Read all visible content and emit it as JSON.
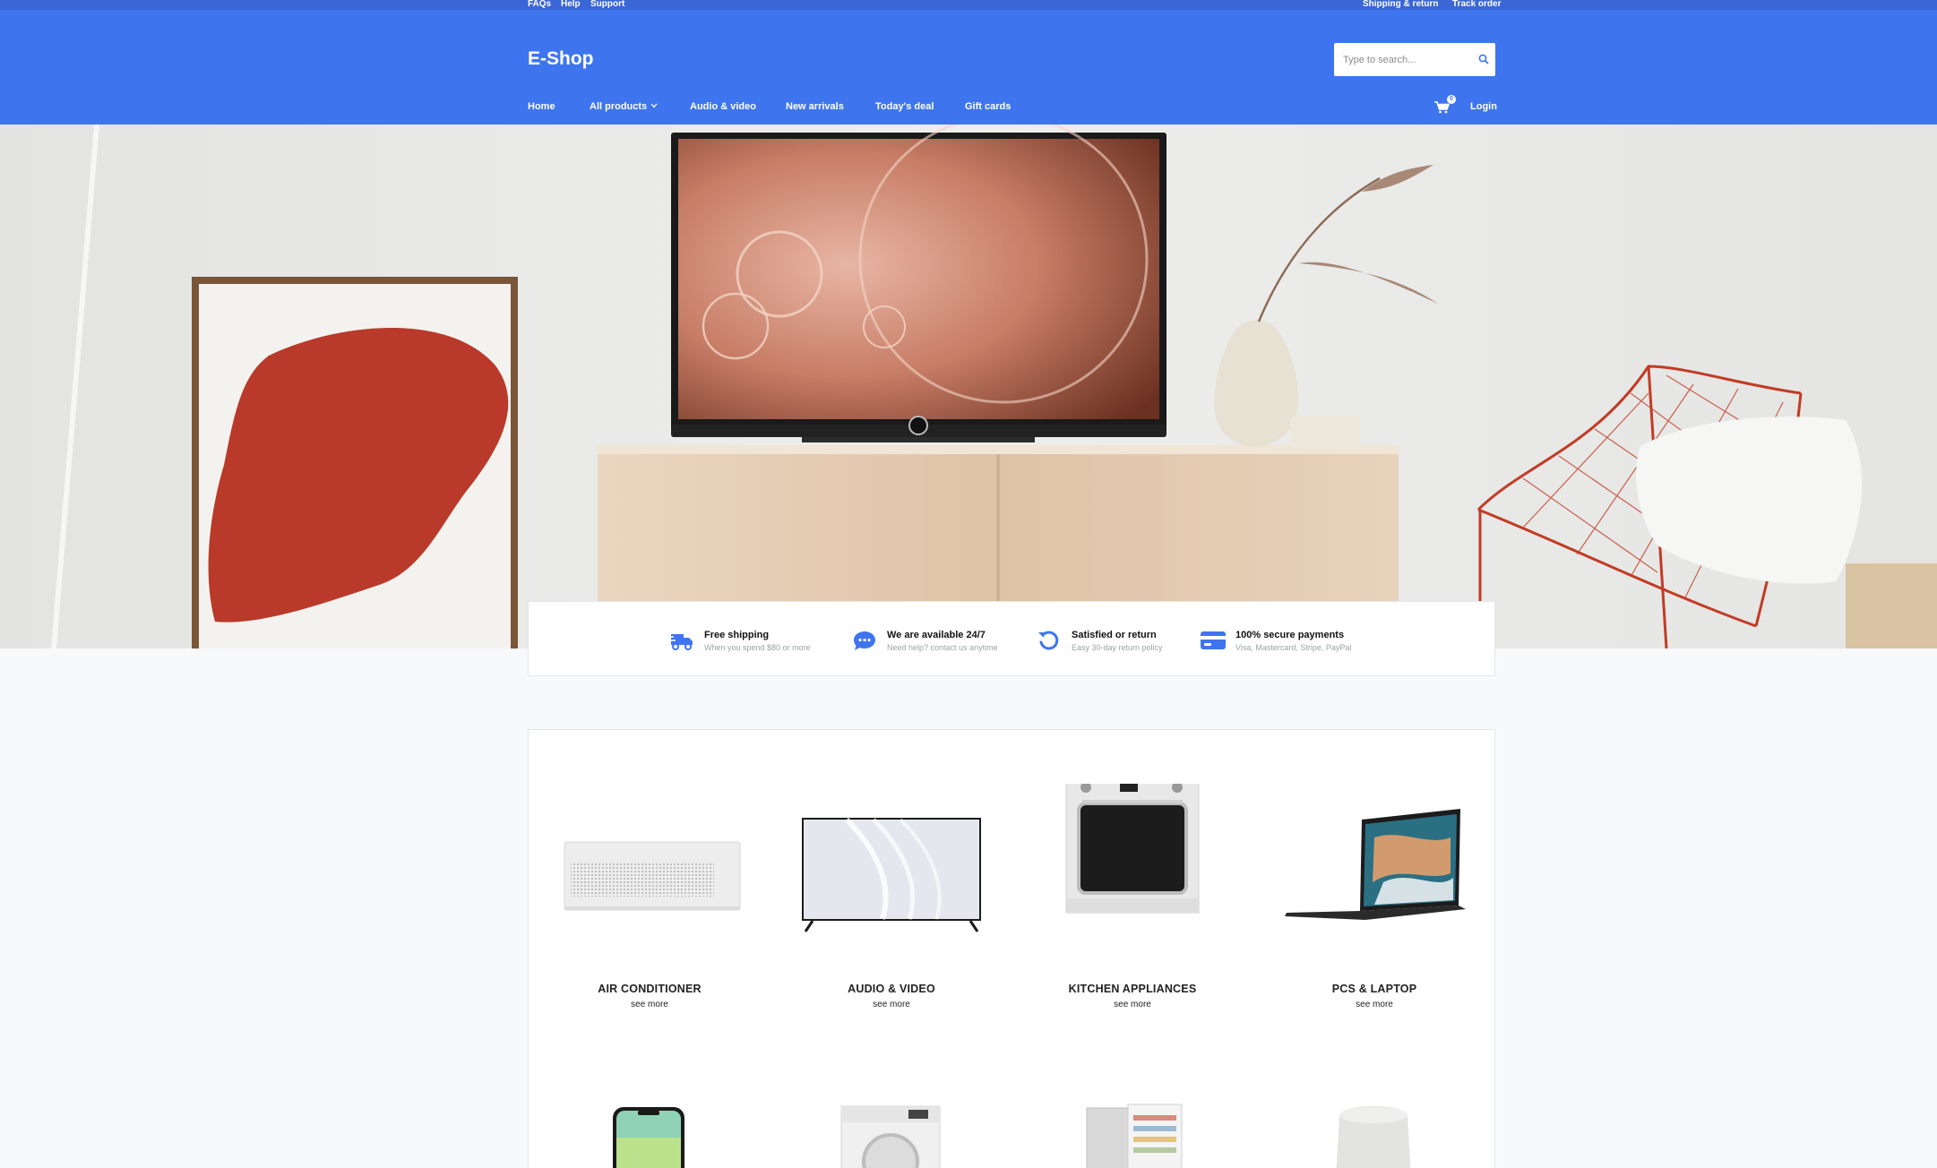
{
  "topbar": {
    "left_links": [
      "FAQs",
      "Help",
      "Support"
    ],
    "right_links": [
      "Shipping & return",
      "Track order"
    ]
  },
  "header": {
    "brand": "E-Shop",
    "search_placeholder": "Type to search...",
    "nav": [
      "Home",
      "All products",
      "Audio & video",
      "New arrivals",
      "Today's deal",
      "Gift cards"
    ],
    "cart_count": "0",
    "login_label": "Login"
  },
  "features": [
    {
      "icon": "truck-icon",
      "title": "Free shipping",
      "subtitle": "When you spend $80 or more"
    },
    {
      "icon": "chat-icon",
      "title": "We are available 24/7",
      "subtitle": "Need help? contact us anytime"
    },
    {
      "icon": "return-icon",
      "title": "Satisfied or return",
      "subtitle": "Easy 30-day return policy"
    },
    {
      "icon": "credit-card-icon",
      "title": "100% secure payments",
      "subtitle": "Visa, Mastercard, Stripe, PayPal"
    }
  ],
  "categories": [
    {
      "name": "AIR CONDITIONER",
      "link": "see more",
      "icon": "air-conditioner-icon"
    },
    {
      "name": "AUDIO & VIDEO",
      "link": "see more",
      "icon": "tv-icon"
    },
    {
      "name": "KITCHEN APPLIANCES",
      "link": "see more",
      "icon": "oven-icon"
    },
    {
      "name": "PCS & LAPTOP",
      "link": "see more",
      "icon": "laptop-icon"
    }
  ],
  "categories_row2_icons": [
    "smartphone-icon",
    "washing-machine-icon",
    "refrigerator-icon",
    "smart-speaker-icon"
  ],
  "colors": {
    "header": "#3e75ee",
    "topbar": "#3a66d6",
    "accent": "#3e75ee"
  }
}
